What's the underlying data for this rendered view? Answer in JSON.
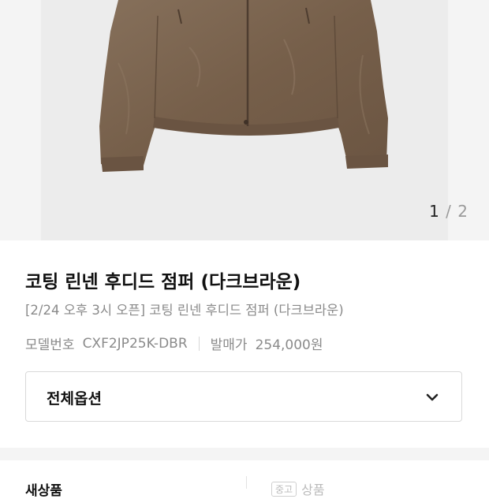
{
  "gallery": {
    "current": "1",
    "separator": "/",
    "total": "2",
    "jacket_color": "#7a634e"
  },
  "product": {
    "title": "코팅 린넨 후디드 점퍼 (다크브라운)",
    "subtitle": "[2/24 오후 3시 오픈] 코팅 린넨 후디드 점퍼 (다크브라운)",
    "model_label": "모델번호",
    "model_number": "CXF2JP25K-DBR",
    "price_label": "발매가",
    "price": "254,000원"
  },
  "options": {
    "label": "전체옵션",
    "icon": "chevron-down-icon"
  },
  "tabs": {
    "new_label": "새상품",
    "used_badge": "중고",
    "used_label": "상품"
  }
}
